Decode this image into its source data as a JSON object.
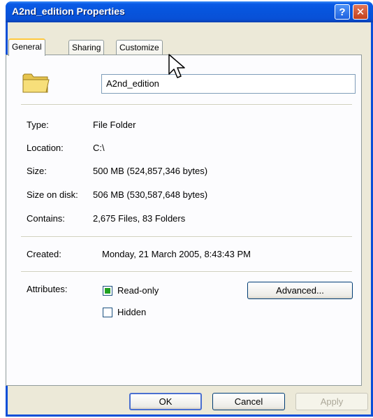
{
  "window": {
    "title": "A2nd_edition Properties",
    "help_glyph": "?",
    "close_glyph": "✕"
  },
  "tabs": [
    {
      "label": "General",
      "active": true
    },
    {
      "label": "Sharing",
      "active": false
    },
    {
      "label": "Customize",
      "active": false
    }
  ],
  "folder": {
    "icon": "folder-icon",
    "name": "A2nd_edition"
  },
  "details": [
    {
      "label": "Type:",
      "value": "File Folder"
    },
    {
      "label": "Location:",
      "value": "C:\\"
    },
    {
      "label": "Size:",
      "value": "500 MB (524,857,346 bytes)"
    },
    {
      "label": "Size on disk:",
      "value": "506 MB (530,587,648 bytes)"
    },
    {
      "label": "Contains:",
      "value": "2,675 Files, 83 Folders"
    }
  ],
  "created": {
    "label": "Created:",
    "value": "Monday, 21 March 2005, 8:43:43 PM"
  },
  "attributes": {
    "label": "Attributes:",
    "readonly": {
      "label": "Read-only",
      "checked": true
    },
    "hidden": {
      "label": "Hidden",
      "checked": false
    },
    "advanced_label": "Advanced..."
  },
  "buttons": {
    "ok": "OK",
    "cancel": "Cancel",
    "apply": "Apply"
  },
  "colors": {
    "titlebar": "#0754dc",
    "face": "#ece9d8",
    "tab_highlight": "#ffc83c"
  }
}
